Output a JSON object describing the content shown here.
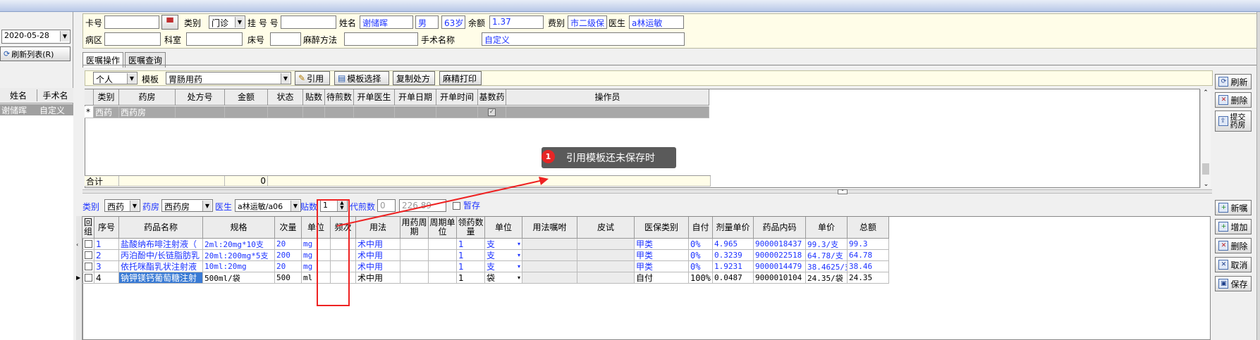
{
  "header": {
    "card_label": "卡号",
    "card_value": "",
    "type_label": "类别",
    "type_value": "门诊",
    "reg_label": "挂 号 号",
    "reg_value": "",
    "name_label": "姓名",
    "name_value": "谢储晖",
    "sex_value": "男",
    "age_value": "63岁",
    "balance_label": "余额",
    "balance_value": "1.37",
    "fee_label": "费别",
    "fee_value": "市二级保",
    "doctor_label": "医生",
    "doctor_value": "a林运敏",
    "ward_label": "病区",
    "ward_value": "",
    "dept_label": "科室",
    "dept_value": "",
    "bed_label": "床号",
    "bed_value": "",
    "anes_label": "麻醉方法",
    "anes_value": "",
    "surgery_label": "手术名称",
    "surgery_value": "自定义"
  },
  "left": {
    "date_value": "2020-05-28",
    "refresh_label": "刷新列表(R)",
    "col_name": "姓名",
    "col_surgery": "手术名",
    "row_name": "谢储晖",
    "row_surgery": "自定义"
  },
  "tabs": [
    "医嘱操作",
    "医嘱查询"
  ],
  "toolbar": {
    "scope_value": "个人",
    "template_label": "模板",
    "template_value": "胃肠用药",
    "quote_btn": "引用",
    "template_select_btn": "模板选择",
    "copy_btn": "复制处方",
    "narcotic_print_btn": "麻精打印"
  },
  "upper_grid": {
    "columns": [
      "类别",
      "药房",
      "处方号",
      "金额",
      "状态",
      "贴数",
      "待煎数",
      "开单医生",
      "开单日期",
      "开单时间",
      "基数药",
      "操作员"
    ],
    "row": {
      "marker": "*",
      "type": "西药",
      "pharmacy": "西药房"
    },
    "total_label": "合计",
    "total_amount": "0"
  },
  "annotation": {
    "number": "1",
    "text": "引用模板还未保存时"
  },
  "right_buttons_top": [
    "刷新",
    "删除",
    "提交药房"
  ],
  "filter": {
    "type_label": "类别",
    "type_value": "西药",
    "pharmacy_label": "药房",
    "pharmacy_value": "西药房",
    "doctor_label": "医生",
    "doctor_value": "a林运敏/a06",
    "doses_label": "贴数",
    "doses_value": "1",
    "decoct_label": "代煎数",
    "decoct_value": "0",
    "amount_value": "226.89",
    "temp_save_label": "暂存"
  },
  "lower_grid": {
    "columns": [
      "回组",
      "序号",
      "药品名称",
      "规格",
      "次量",
      "单位",
      "频次",
      "用法",
      "用药周期",
      "周期单位",
      "领药数量",
      "单位",
      "用法嘱咐",
      "皮试",
      "医保类别",
      "自付",
      "剂量单价",
      "药品内码",
      "单价",
      "总额"
    ],
    "rows": [
      {
        "seq": "1",
        "name": "盐酸纳布啡注射液（",
        "spec": "2ml:20mg*10支",
        "dose": "20",
        "unit": "mg",
        "freq": "",
        "usage": "术中用",
        "qty": "1",
        "qunit": "支",
        "ins": "甲类",
        "self": "0%",
        "dprice": "4.965",
        "code": "9000018437",
        "price": "99.3/支",
        "total": "99.3"
      },
      {
        "seq": "2",
        "name": "丙泊酚中/长链脂肪乳",
        "spec": "20ml:200mg*5支",
        "dose": "200",
        "unit": "mg",
        "freq": "",
        "usage": "术中用",
        "qty": "1",
        "qunit": "支",
        "ins": "甲类",
        "self": "0%",
        "dprice": "0.3239",
        "code": "9000022518",
        "price": "64.78/支",
        "total": "64.78"
      },
      {
        "seq": "3",
        "name": "依托咪酯乳状注射液",
        "spec": "10ml:20mg",
        "dose": "20",
        "unit": "mg",
        "freq": "",
        "usage": "术中用",
        "qty": "1",
        "qunit": "支",
        "ins": "甲类",
        "self": "0%",
        "dprice": "1.9231",
        "code": "9000014479",
        "price": "38.4625/支",
        "total": "38.46"
      },
      {
        "seq": "4",
        "name": "钠钾镁钙葡萄糖注射",
        "spec": "500ml/袋",
        "dose": "500",
        "unit": "ml",
        "freq": "",
        "usage": "术中用",
        "qty": "1",
        "qunit": "袋",
        "ins": "自付",
        "self": "100%",
        "dprice": "0.0487",
        "code": "9000010104",
        "price": "24.35/袋",
        "total": "24.35"
      }
    ]
  },
  "right_buttons_bottom": [
    "新嘱",
    "增加",
    "删除",
    "取消",
    "保存"
  ],
  "colors": {
    "accent_blue": "#1d33ff",
    "highlight_red": "#ee2222",
    "selection": "#3a7bd5"
  }
}
